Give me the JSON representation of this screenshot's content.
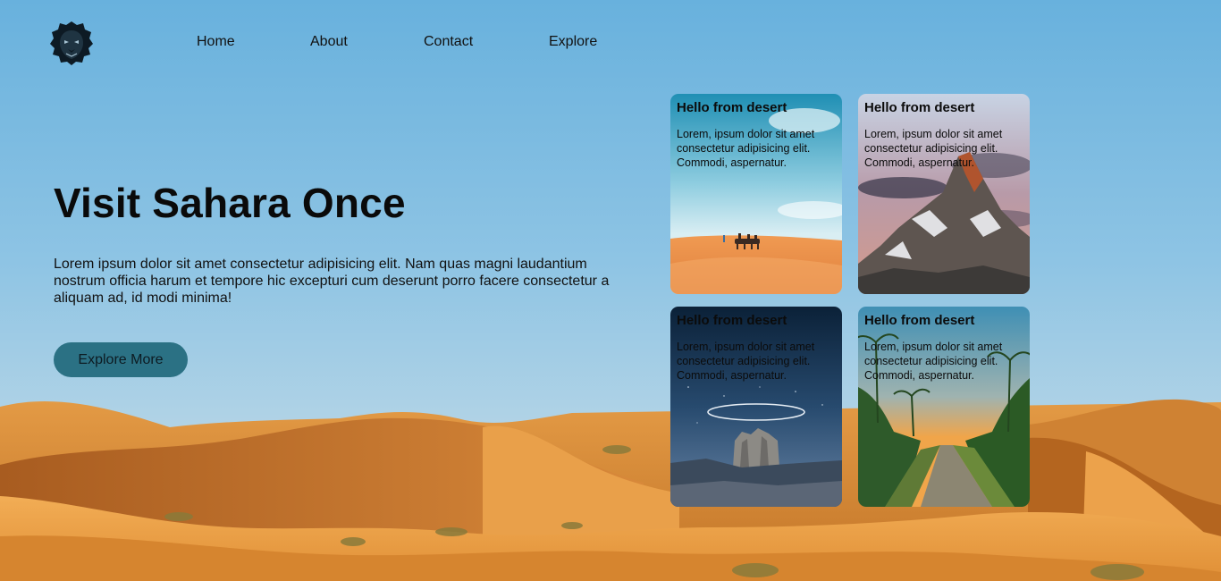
{
  "nav": {
    "logo_icon": "lion-head-logo-icon",
    "items": [
      {
        "label": "Home"
      },
      {
        "label": "About"
      },
      {
        "label": "Contact"
      },
      {
        "label": "Explore"
      }
    ]
  },
  "hero": {
    "title": "Visit Sahara Once",
    "text": "Lorem ipsum dolor sit amet consectetur adipisicing elit. Nam quas magni laudantium nostrum officia harum et tempore hic excepturi cum deserunt porro facere consectetur a aliquam ad, id modi minima!",
    "cta_label": "Explore More"
  },
  "cards": [
    {
      "title": "Hello from desert",
      "text": "Lorem, ipsum dolor sit amet consectetur adipisicing elit. Commodi, aspernatur.",
      "image": "desert-camel-caravan"
    },
    {
      "title": "Hello from desert",
      "text": "Lorem, ipsum dolor sit amet consectetur adipisicing elit. Commodi, aspernatur.",
      "image": "snowy-mountain-peak"
    },
    {
      "title": "Hello from desert",
      "text": "Lorem, ipsum dolor sit amet consectetur adipisicing elit. Commodi, aspernatur.",
      "image": "night-rock-formation-halo"
    },
    {
      "title": "Hello from desert",
      "text": "Lorem, ipsum dolor sit amet consectetur adipisicing elit. Commodi, aspernatur.",
      "image": "palm-tree-sunset-road"
    }
  ],
  "colors": {
    "sky_top": "#6fb4df",
    "sky_bottom": "#a8d0e8",
    "sand_light": "#f0a54a",
    "sand_dark": "#a5581c",
    "button": "#2b7184"
  }
}
